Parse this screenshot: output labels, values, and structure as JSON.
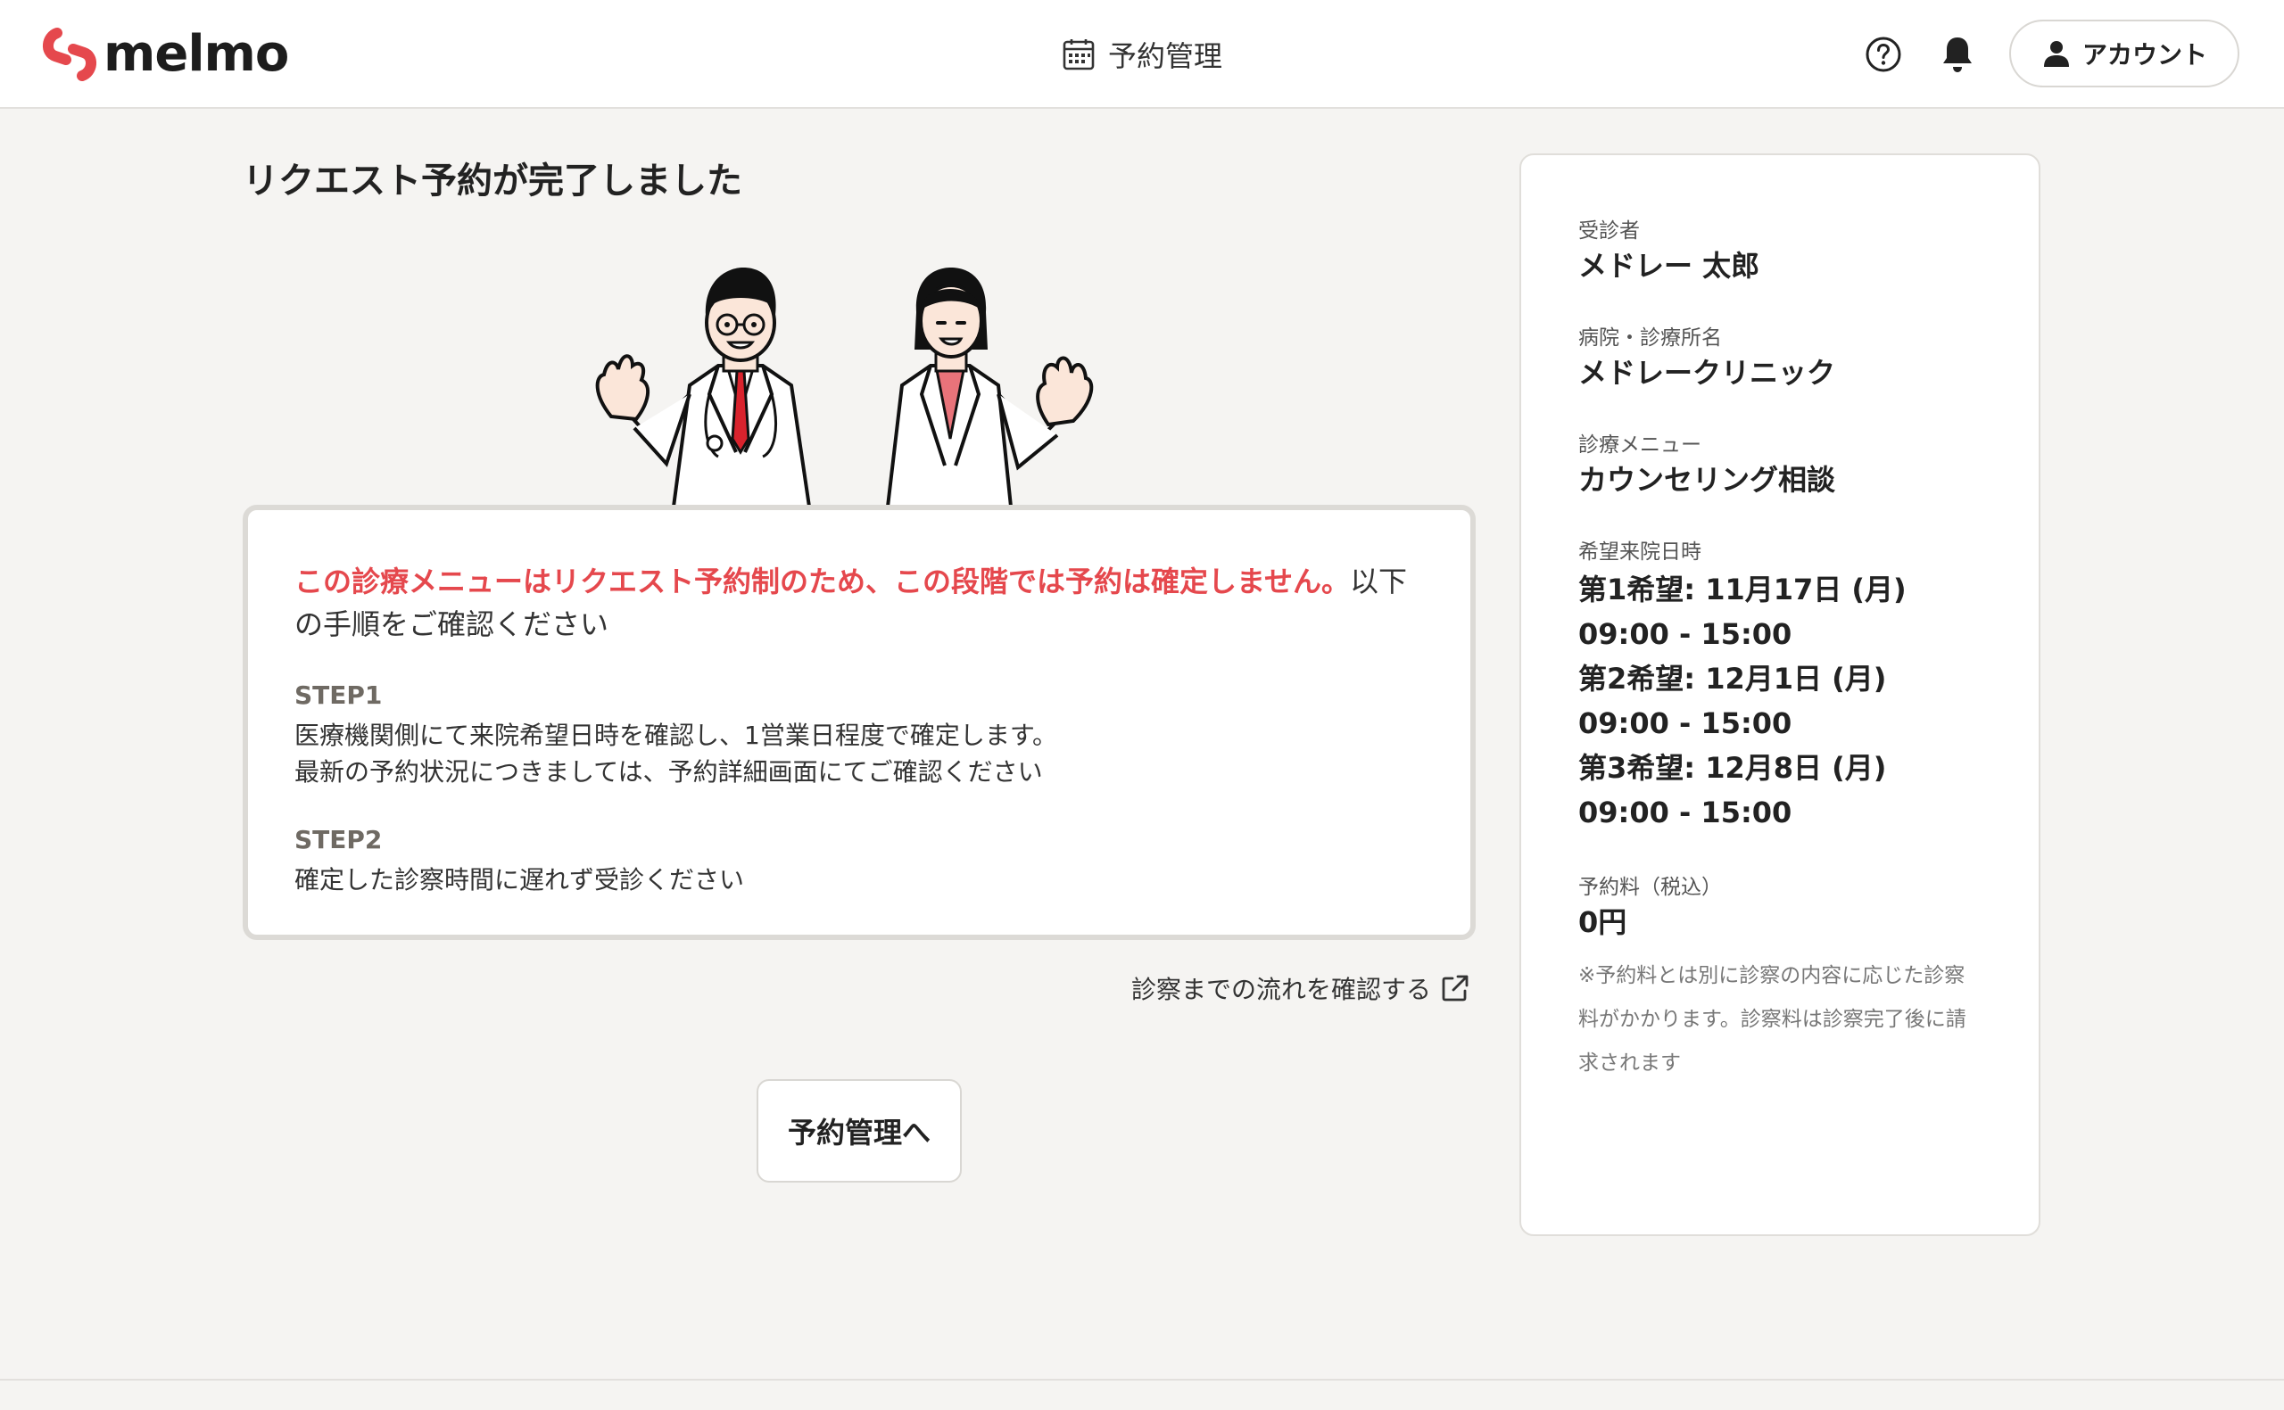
{
  "header": {
    "logo_text": "melmo",
    "nav_label": "予約管理",
    "account_label": "アカウント"
  },
  "main": {
    "title": "リクエスト予約が完了しました",
    "notice_red": "この診療メニューはリクエスト予約制のため、この段階では予約は確定しません。",
    "notice_rest": "以下の手順をご確認ください",
    "steps": [
      {
        "label": "STEP1",
        "lines": [
          "医療機関側にて来院希望日時を確認し、1営業日程度で確定します。",
          "最新の予約状況につきましては、予約詳細画面にてご確認ください"
        ]
      },
      {
        "label": "STEP2",
        "lines": [
          "確定した診察時間に遅れず受診ください"
        ]
      }
    ],
    "flow_link": "診察までの流れを確認する",
    "manage_button": "予約管理へ"
  },
  "summary": {
    "patient_label": "受診者",
    "patient_value": "メドレー 太郎",
    "clinic_label": "病院・診療所名",
    "clinic_value": "メドレークリニック",
    "menu_label": "診療メニュー",
    "menu_value": "カウンセリング相談",
    "dates_label": "希望来院日時",
    "dates": [
      "第1希望: 11月17日 (月) 09:00 - 15:00",
      "第2希望: 12月1日 (月) 09:00 - 15:00",
      "第3希望: 12月8日 (月) 09:00 - 15:00"
    ],
    "fee_label": "予約料（税込）",
    "fee_value": "0円",
    "note": "※予約料とは別に診察の内容に応じた診察料がかかります。診察料は診察完了後に請求されます"
  },
  "colors": {
    "brand": "#e5484d",
    "background": "#f5f4f2",
    "card_border": "#dcdad6"
  }
}
